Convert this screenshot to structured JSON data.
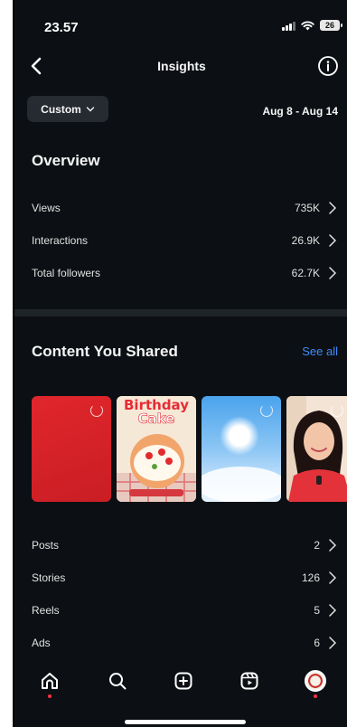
{
  "status": {
    "time": "23.57",
    "battery": "26"
  },
  "header": {
    "title": "Insights"
  },
  "filter": {
    "custom_label": "Custom",
    "date_range": "Aug 8 - Aug 14"
  },
  "overview": {
    "title": "Overview",
    "rows": [
      {
        "label": "Views",
        "value": "735K"
      },
      {
        "label": "Interactions",
        "value": "26.9K"
      },
      {
        "label": "Total followers",
        "value": "62.7K"
      }
    ]
  },
  "content": {
    "title": "Content You Shared",
    "see_all": "See all",
    "thumb_text": {
      "title1": "Birthday",
      "title2": "Cake"
    },
    "rows": [
      {
        "label": "Posts",
        "value": "2"
      },
      {
        "label": "Stories",
        "value": "126"
      },
      {
        "label": "Reels",
        "value": "5"
      },
      {
        "label": "Ads",
        "value": "6"
      }
    ]
  },
  "colors": {
    "background": "#0c1014",
    "accent": "#3f8cf7",
    "notification": "#ff3040"
  },
  "nav_icons": [
    "home-icon",
    "search-icon",
    "create-icon",
    "reels-icon",
    "profile-avatar"
  ]
}
